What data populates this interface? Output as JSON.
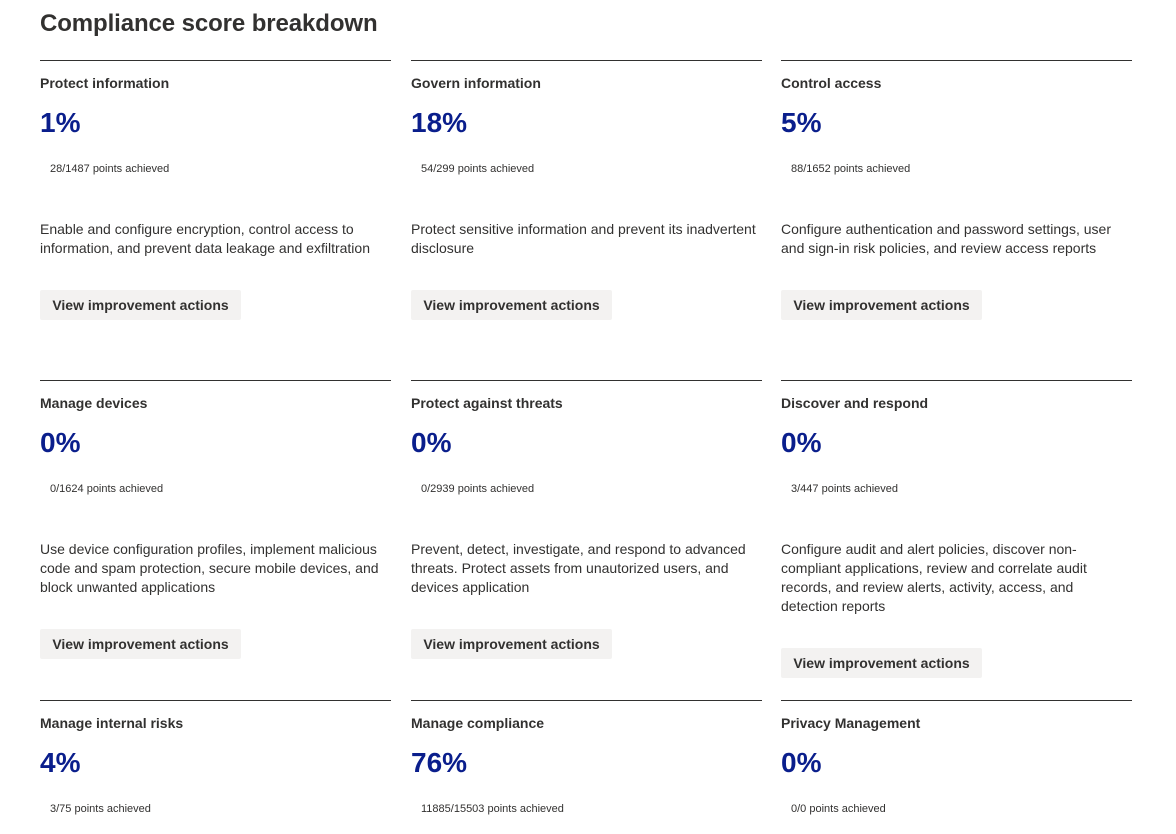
{
  "page": {
    "title": "Compliance score breakdown"
  },
  "colors": {
    "accent": "#0a1e8c",
    "text": "#323130",
    "button_bg": "#f3f2f1"
  },
  "cards": [
    {
      "title": "Protect information",
      "percent": "1%",
      "points": "28/1487 points achieved",
      "description": "Enable and configure encryption, control access to information, and prevent data leakage and exfiltration",
      "button": "View improvement actions"
    },
    {
      "title": "Govern information",
      "percent": "18%",
      "points": "54/299 points achieved",
      "description": "Protect sensitive information and prevent its inadvertent disclosure",
      "button": "View improvement actions"
    },
    {
      "title": "Control access",
      "percent": "5%",
      "points": "88/1652 points achieved",
      "description": "Configure authentication and password settings, user and sign-in risk policies, and review access reports",
      "button": "View improvement actions"
    },
    {
      "title": "Manage devices",
      "percent": "0%",
      "points": "0/1624 points achieved",
      "description": "Use device configuration profiles, implement malicious code and spam protection, secure mobile devices, and block unwanted applications",
      "button": "View improvement actions"
    },
    {
      "title": "Protect against threats",
      "percent": "0%",
      "points": "0/2939 points achieved",
      "description": "Prevent, detect, investigate, and respond to advanced threats. Protect assets from unautorized users, and devices application",
      "button": "View improvement actions"
    },
    {
      "title": "Discover and respond",
      "percent": "0%",
      "points": "3/447 points achieved",
      "description": "Configure audit and alert policies, discover non-compliant applications, review and correlate audit records, and review alerts, activity, access, and detection reports",
      "button": "View improvement actions"
    },
    {
      "title": "Manage internal risks",
      "percent": "4%",
      "points": "3/75 points achieved"
    },
    {
      "title": "Manage compliance",
      "percent": "76%",
      "points": "11885/15503 points achieved"
    },
    {
      "title": "Privacy Management",
      "percent": "0%",
      "points": "0/0 points achieved"
    }
  ]
}
